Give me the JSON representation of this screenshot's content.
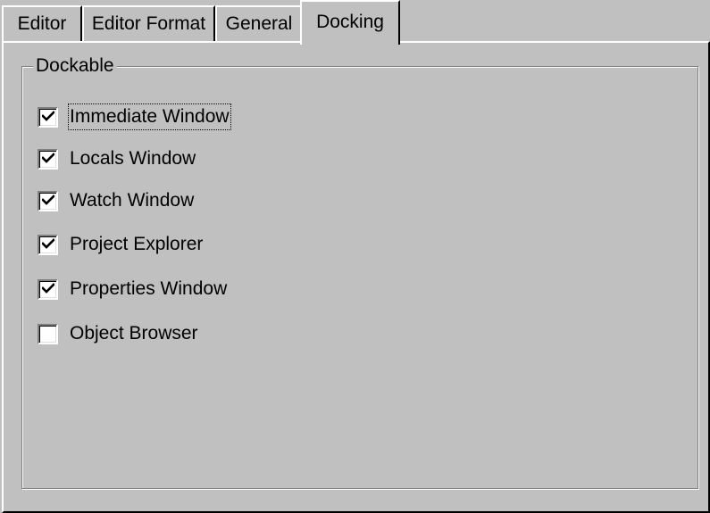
{
  "tabs": [
    {
      "label": "Editor",
      "selected": false
    },
    {
      "label": "Editor Format",
      "selected": false
    },
    {
      "label": "General",
      "selected": false
    },
    {
      "label": "Docking",
      "selected": true
    }
  ],
  "dockable_group": {
    "title": "Dockable",
    "items": [
      {
        "label": "Immediate Window",
        "checked": true,
        "focused": true
      },
      {
        "label": "Locals Window",
        "checked": true,
        "focused": false
      },
      {
        "label": "Watch Window",
        "checked": true,
        "focused": false
      },
      {
        "label": "Project Explorer",
        "checked": true,
        "focused": false
      },
      {
        "label": "Properties Window",
        "checked": true,
        "focused": false
      },
      {
        "label": "Object Browser",
        "checked": false,
        "focused": false
      }
    ]
  },
  "colors": {
    "face": "#c0c0c0",
    "highlight": "#ffffff",
    "shadow": "#808080",
    "dark_shadow": "#000000",
    "checkbox_background": "#ffffff"
  },
  "icons": {
    "checkmark": "check-icon"
  }
}
